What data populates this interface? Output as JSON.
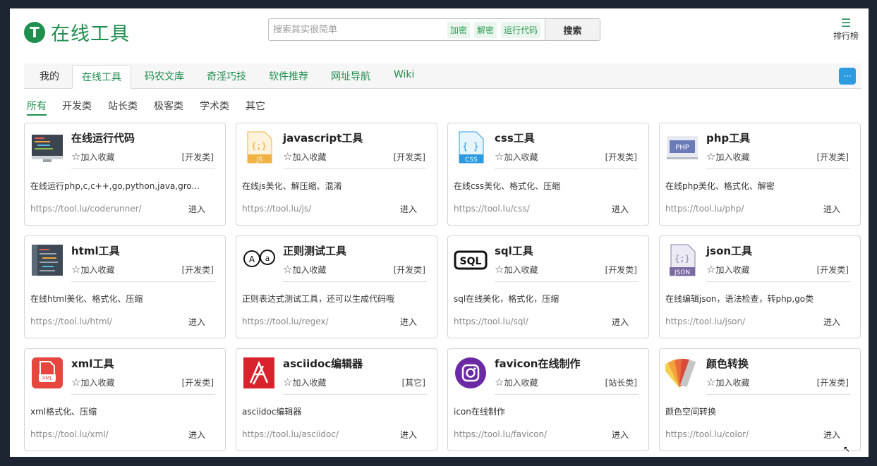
{
  "header": {
    "logo_mark": "T",
    "logo_text": "在线工具",
    "search_placeholder": "搜索其实很简单",
    "quick_tags": [
      "加密",
      "解密",
      "运行代码"
    ],
    "search_button": "搜索",
    "rank_label": "排行榜"
  },
  "nav": {
    "tabs": [
      "我的",
      "在线工具",
      "码农文库",
      "奇淫巧技",
      "软件推荐",
      "网址导航",
      "Wiki"
    ]
  },
  "filters": [
    "所有",
    "开发类",
    "站长类",
    "极客类",
    "学术类",
    "其它"
  ],
  "fav_label": "加入收藏",
  "enter_label": "进入",
  "tools": [
    {
      "title": "在线运行代码",
      "category": "[开发类]",
      "desc": "在线运行php,c,c++,go,python,java,gro...",
      "url": "https://tool.lu/coderunner/",
      "icon": "monitor-code-icon"
    },
    {
      "title": "javascript工具",
      "category": "[开发类]",
      "desc": "在线js美化、解压缩、混淆",
      "url": "https://tool.lu/js/",
      "icon": "js-file-icon",
      "icon_text": "JS"
    },
    {
      "title": "css工具",
      "category": "[开发类]",
      "desc": "在线css美化、格式化、压缩",
      "url": "https://tool.lu/css/",
      "icon": "css-file-icon",
      "icon_text": "CSS"
    },
    {
      "title": "php工具",
      "category": "[开发类]",
      "desc": "在线php美化、格式化、解密",
      "url": "https://tool.lu/php/",
      "icon": "php-window-icon",
      "icon_text": "PHP"
    },
    {
      "title": "html工具",
      "category": "[开发类]",
      "desc": "在线html美化、格式化、压缩",
      "url": "https://tool.lu/html/",
      "icon": "html-code-icon"
    },
    {
      "title": "正则测试工具",
      "category": "[开发类]",
      "desc": "正则表达式测试工具，还可以生成代码哦",
      "url": "https://tool.lu/regex/",
      "icon": "regex-bubbles-icon"
    },
    {
      "title": "sql工具",
      "category": "[开发类]",
      "desc": "sql在线美化，格式化，压缩",
      "url": "https://tool.lu/sql/",
      "icon": "sql-icon",
      "icon_text": "SQL"
    },
    {
      "title": "json工具",
      "category": "[开发类]",
      "desc": "在线编辑json，语法检查，转php,go类",
      "url": "https://tool.lu/json/",
      "icon": "json-file-icon",
      "icon_text": "JSON"
    },
    {
      "title": "xml工具",
      "category": "[开发类]",
      "desc": "xml格式化、压缩",
      "url": "https://tool.lu/xml/",
      "icon": "xml-file-icon",
      "icon_text": "XML"
    },
    {
      "title": "asciidoc编辑器",
      "category": "[其它]",
      "desc": "asciidoc编辑器",
      "url": "https://tool.lu/asciidoc/",
      "icon": "asciidoc-icon"
    },
    {
      "title": "favicon在线制作",
      "category": "[站长类]",
      "desc": "icon在线制作",
      "url": "https://tool.lu/favicon/",
      "icon": "instagram-icon"
    },
    {
      "title": "颜色转换",
      "category": "[开发类]",
      "desc": "颜色空间转换",
      "url": "https://tool.lu/color/",
      "icon": "color-swatch-icon"
    }
  ],
  "colors": {
    "brand": "#1e8f4e",
    "accent": "#2d9be0"
  }
}
